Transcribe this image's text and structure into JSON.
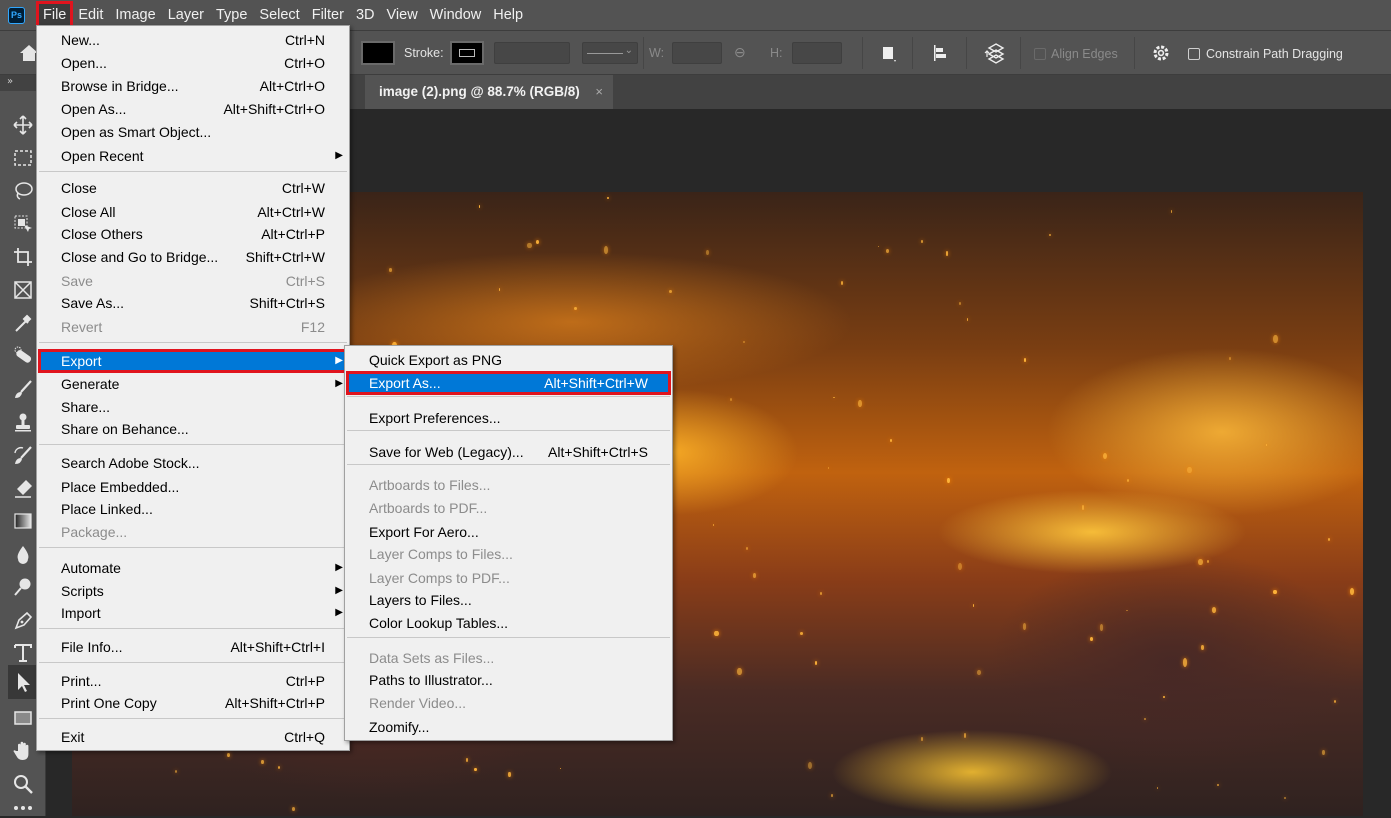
{
  "app": {
    "logo": "Ps"
  },
  "menubar": {
    "items": [
      "File",
      "Edit",
      "Image",
      "Layer",
      "Type",
      "Select",
      "Filter",
      "3D",
      "View",
      "Window",
      "Help"
    ],
    "active": "File"
  },
  "options_bar": {
    "stroke_label": "Stroke:",
    "w_label": "W:",
    "h_label": "H:",
    "align_edges_label": "Align Edges",
    "constrain_label": "Constrain Path Dragging"
  },
  "document_tab": {
    "title": "image (2).png @ 88.7% (RGB/8)",
    "close": "×"
  },
  "toolbar": {
    "expand": "»",
    "tools": [
      "move-tool",
      "rectangular-marquee-tool",
      "lasso-tool",
      "object-selection-tool",
      "crop-tool",
      "frame-tool",
      "eyedropper-tool",
      "healing-brush-tool",
      "brush-tool",
      "clone-stamp-tool",
      "history-brush-tool",
      "eraser-tool",
      "gradient-tool",
      "blur-tool",
      "dodge-tool",
      "pen-tool",
      "type-tool",
      "path-selection-tool",
      "rectangle-tool",
      "hand-tool",
      "zoom-tool",
      "more-tools"
    ],
    "selected": "path-selection-tool"
  },
  "file_menu": {
    "items": [
      {
        "label": "New...",
        "shortcut": "Ctrl+N"
      },
      {
        "label": "Open...",
        "shortcut": "Ctrl+O"
      },
      {
        "label": "Browse in Bridge...",
        "shortcut": "Alt+Ctrl+O"
      },
      {
        "label": "Open As...",
        "shortcut": "Alt+Shift+Ctrl+O"
      },
      {
        "label": "Open as Smart Object...",
        "shortcut": ""
      },
      {
        "label": "Open Recent",
        "shortcut": "",
        "submenu": true
      },
      {
        "separator": true
      },
      {
        "label": "Close",
        "shortcut": "Ctrl+W"
      },
      {
        "label": "Close All",
        "shortcut": "Alt+Ctrl+W"
      },
      {
        "label": "Close Others",
        "shortcut": "Alt+Ctrl+P"
      },
      {
        "label": "Close and Go to Bridge...",
        "shortcut": "Shift+Ctrl+W"
      },
      {
        "label": "Save",
        "shortcut": "Ctrl+S",
        "disabled": true
      },
      {
        "label": "Save As...",
        "shortcut": "Shift+Ctrl+S"
      },
      {
        "label": "Revert",
        "shortcut": "F12",
        "disabled": true
      },
      {
        "separator": true
      },
      {
        "label": "Export",
        "shortcut": "",
        "submenu": true,
        "highlighted": true
      },
      {
        "label": "Generate",
        "shortcut": "",
        "submenu": true
      },
      {
        "label": "Share...",
        "shortcut": ""
      },
      {
        "label": "Share on Behance...",
        "shortcut": ""
      },
      {
        "separator": true
      },
      {
        "label": "Search Adobe Stock...",
        "shortcut": ""
      },
      {
        "label": "Place Embedded...",
        "shortcut": ""
      },
      {
        "label": "Place Linked...",
        "shortcut": ""
      },
      {
        "label": "Package...",
        "shortcut": "",
        "disabled": true
      },
      {
        "separator": true
      },
      {
        "label": "Automate",
        "shortcut": "",
        "submenu": true
      },
      {
        "label": "Scripts",
        "shortcut": "",
        "submenu": true
      },
      {
        "label": "Import",
        "shortcut": "",
        "submenu": true
      },
      {
        "separator": true
      },
      {
        "label": "File Info...",
        "shortcut": "Alt+Shift+Ctrl+I"
      },
      {
        "separator": true
      },
      {
        "label": "Print...",
        "shortcut": "Ctrl+P"
      },
      {
        "label": "Print One Copy",
        "shortcut": "Alt+Shift+Ctrl+P"
      },
      {
        "separator": true
      },
      {
        "label": "Exit",
        "shortcut": "Ctrl+Q"
      }
    ]
  },
  "export_menu": {
    "items": [
      {
        "label": "Quick Export as PNG",
        "shortcut": ""
      },
      {
        "label": "Export As...",
        "shortcut": "Alt+Shift+Ctrl+W",
        "highlighted": true
      },
      {
        "separator": true
      },
      {
        "label": "Export Preferences...",
        "shortcut": ""
      },
      {
        "separator": true
      },
      {
        "label": "Save for Web (Legacy)...",
        "shortcut": "Alt+Shift+Ctrl+S"
      },
      {
        "separator": true
      },
      {
        "label": "Artboards to Files...",
        "shortcut": "",
        "disabled": true
      },
      {
        "label": "Artboards to PDF...",
        "shortcut": "",
        "disabled": true
      },
      {
        "label": "Export For Aero...",
        "shortcut": ""
      },
      {
        "label": "Layer Comps to Files...",
        "shortcut": "",
        "disabled": true
      },
      {
        "label": "Layer Comps to PDF...",
        "shortcut": "",
        "disabled": true
      },
      {
        "label": "Layers to Files...",
        "shortcut": ""
      },
      {
        "label": "Color Lookup Tables...",
        "shortcut": ""
      },
      {
        "separator": true
      },
      {
        "label": "Data Sets as Files...",
        "shortcut": "",
        "disabled": true
      },
      {
        "label": "Paths to Illustrator...",
        "shortcut": ""
      },
      {
        "label": "Render Video...",
        "shortcut": "",
        "disabled": true
      },
      {
        "label": "Zoomify...",
        "shortcut": ""
      }
    ]
  },
  "colors": {
    "highlight": "#0078d7",
    "annotation_box": "#e0141e"
  }
}
